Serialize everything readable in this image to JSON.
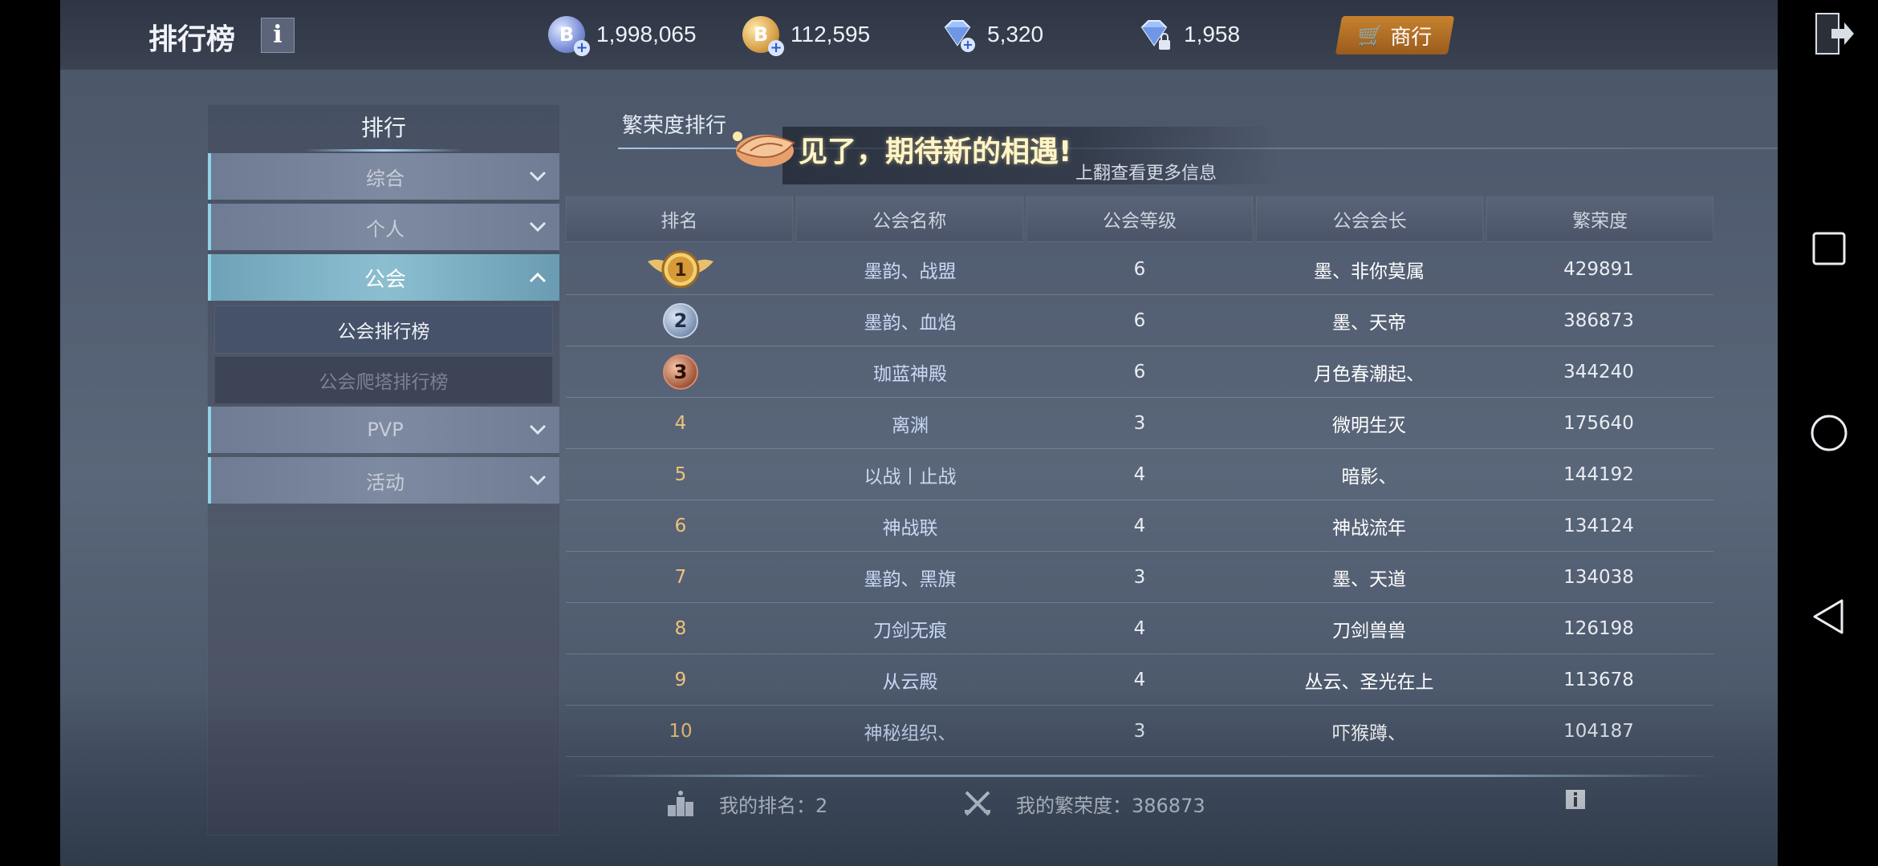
{
  "header": {
    "title": "排行榜",
    "info_label": "i",
    "currencies": [
      {
        "icon": "blue-coin-icon",
        "value": "1,998,065"
      },
      {
        "icon": "gold-coin-icon",
        "value": "112,595"
      },
      {
        "icon": "diamond-icon",
        "value": "5,320"
      },
      {
        "icon": "locked-diamond-icon",
        "value": "1,958"
      }
    ],
    "shop_label": "商行"
  },
  "sidebar": {
    "header": "排行",
    "items": [
      {
        "label": "综合",
        "expanded": false
      },
      {
        "label": "个人",
        "expanded": false
      },
      {
        "label": "公会",
        "expanded": true
      },
      {
        "label": "PVP",
        "expanded": false
      },
      {
        "label": "活动",
        "expanded": false
      }
    ],
    "sub_items": [
      {
        "label": "公会排行榜",
        "selected": true
      },
      {
        "label": "公会爬塔排行榜",
        "selected": false
      }
    ]
  },
  "main": {
    "tab_title": "繁荣度排行",
    "notice": "见了，期待新的相遇!",
    "notice_sub": "上翻查看更多信息",
    "columns": [
      "排名",
      "公会名称",
      "公会等级",
      "公会会长",
      "繁荣度"
    ],
    "rows": [
      {
        "rank": "1",
        "guild": "墨韵、战盟",
        "level": "6",
        "leader": "墨、非你莫属",
        "prosperity": "429891"
      },
      {
        "rank": "2",
        "guild": "墨韵、血焰",
        "level": "6",
        "leader": "墨、天帝",
        "prosperity": "386873"
      },
      {
        "rank": "3",
        "guild": "珈蓝神殿",
        "level": "6",
        "leader": "月色春潮起、",
        "prosperity": "344240"
      },
      {
        "rank": "4",
        "guild": "离渊",
        "level": "3",
        "leader": "微明生灭",
        "prosperity": "175640"
      },
      {
        "rank": "5",
        "guild": "以战丨止战",
        "level": "4",
        "leader": "暗影、",
        "prosperity": "144192"
      },
      {
        "rank": "6",
        "guild": "神战联",
        "level": "4",
        "leader": "神战流年",
        "prosperity": "134124"
      },
      {
        "rank": "7",
        "guild": "墨韵、黑旗",
        "level": "3",
        "leader": "墨、天道",
        "prosperity": "134038"
      },
      {
        "rank": "8",
        "guild": "刀剑无痕",
        "level": "4",
        "leader": "刀剑兽兽",
        "prosperity": "126198"
      },
      {
        "rank": "9",
        "guild": "从云殿",
        "level": "4",
        "leader": "丛云、圣光在上",
        "prosperity": "113678"
      },
      {
        "rank": "10",
        "guild": "神秘组织、",
        "level": "3",
        "leader": "吓猴蹲、",
        "prosperity": "104187"
      }
    ],
    "footer": {
      "my_rank": "我的排名：2",
      "my_prosperity": "我的繁荣度：386873"
    }
  },
  "colors": {
    "accent_cyan": "#8fd3e6",
    "rank_gold": "#f0c27a",
    "guild_text": "#c9d8f5"
  }
}
